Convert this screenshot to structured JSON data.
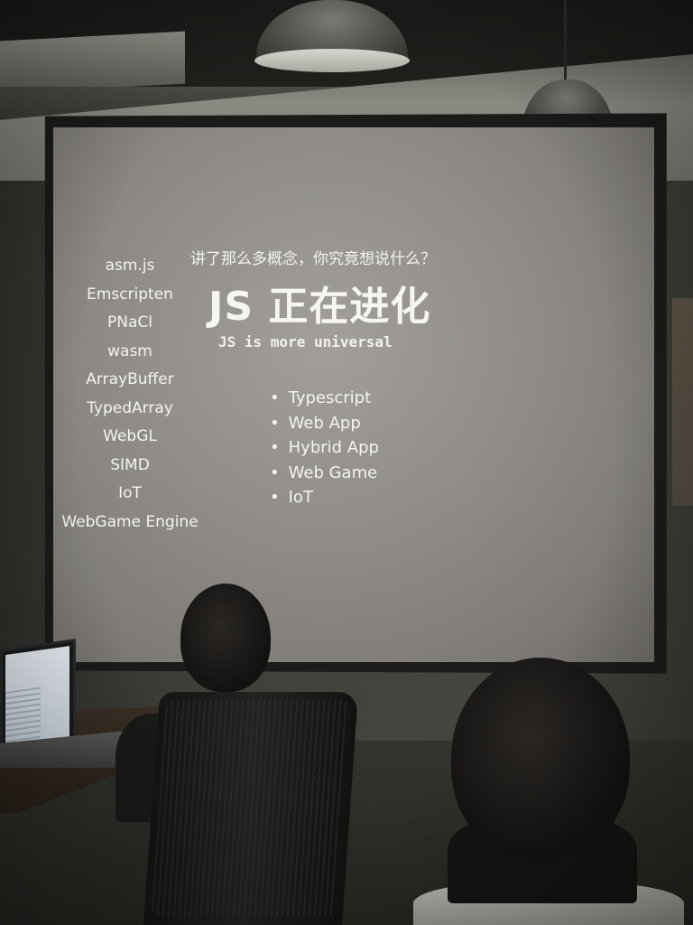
{
  "slide": {
    "side_list": [
      "asm.js",
      "Emscripten",
      "PNaCl",
      "wasm",
      "ArrayBuffer",
      "TypedArray",
      "WebGL",
      "SIMD",
      "IoT",
      "WebGame Engine"
    ],
    "question": "讲了那么多概念，你究竟想说什么？",
    "title": "JS 正在进化",
    "subtitle": "JS is more universal",
    "bullets": [
      "Typescript",
      "Web App",
      "Hybrid App",
      "Web Game",
      "IoT"
    ]
  },
  "colors": {
    "screen": "#9a9792",
    "slide_text": "#f4f3ee",
    "room_dark": "#2c2d28"
  }
}
